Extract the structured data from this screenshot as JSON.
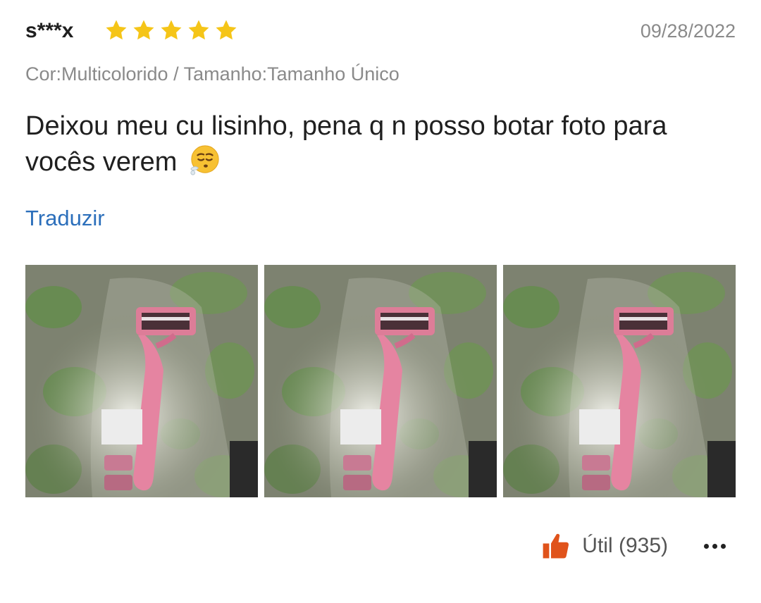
{
  "review": {
    "username": "s***x",
    "rating": 5,
    "rating_max": 5,
    "date": "09/28/2022",
    "variant": "Cor:Multicolorido / Tamanho:Tamanho Único",
    "text": "Deixou meu cu lisinho, pena q n posso botar foto para vocês verem",
    "emoji": "face-exhaling-emoji",
    "translate_label": "Traduzir",
    "photos": [
      {
        "icon": "review-photo-razor"
      },
      {
        "icon": "review-photo-razor"
      },
      {
        "icon": "review-photo-razor"
      }
    ],
    "helpful_label": "Útil (935)",
    "more_icon": "more-options-icon"
  },
  "colors": {
    "star": "#f5c518",
    "link": "#2c6fbb",
    "thumb": "#e0531b",
    "muted_text": "#8a8a8a",
    "body_text": "#1f1f1f"
  }
}
